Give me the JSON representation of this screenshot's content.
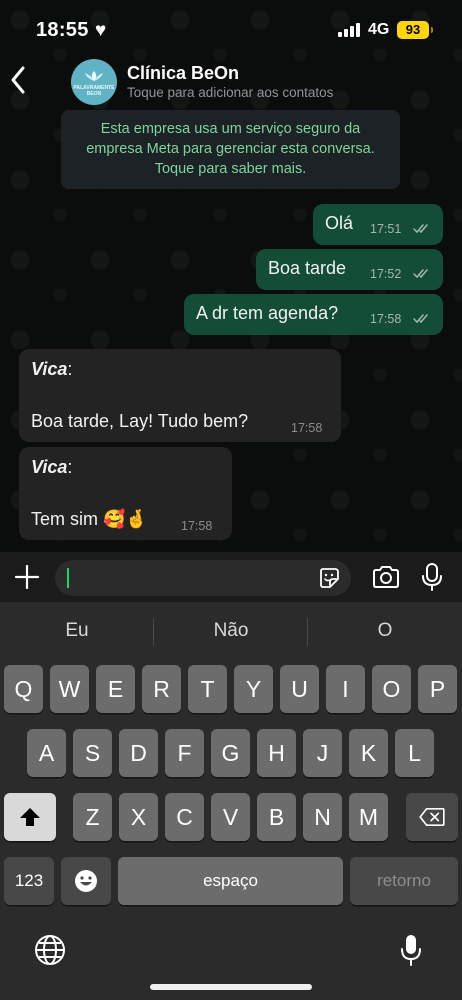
{
  "status_bar": {
    "time": "18:55",
    "heart_icon": "heart-icon",
    "network": "4G",
    "battery": "93",
    "battery_color": "#ffd60a"
  },
  "header": {
    "contact_name": "Clínica BeOn",
    "subtitle": "Toque para adicionar aos contatos",
    "avatar_text": "PALAVRAMENTE BEON"
  },
  "notice": {
    "text": "Esta empresa usa um serviço seguro da empresa Meta para gerenciar esta conversa. Toque para saber mais."
  },
  "messages": [
    {
      "direction": "out",
      "text": "Olá",
      "time": "17:51",
      "status": "read"
    },
    {
      "direction": "out",
      "text": "Boa tarde",
      "time": "17:52",
      "status": "read"
    },
    {
      "direction": "out",
      "text": "A dr tem agenda?",
      "time": "17:58",
      "status": "read"
    },
    {
      "direction": "in",
      "sender": "Vica",
      "text": "Boa tarde, Lay! Tudo bem?",
      "time": "17:58"
    },
    {
      "direction": "in",
      "sender": "Vica",
      "text": "Tem sim 🥰🤞",
      "time": "17:58"
    }
  ],
  "input": {
    "value": "",
    "placeholder": ""
  },
  "keyboard": {
    "suggestions": [
      "Eu",
      "Não",
      "O"
    ],
    "row1": [
      "Q",
      "W",
      "E",
      "R",
      "T",
      "Y",
      "U",
      "I",
      "O",
      "P"
    ],
    "row2": [
      "A",
      "S",
      "D",
      "F",
      "G",
      "H",
      "J",
      "K",
      "L"
    ],
    "row3": [
      "Z",
      "X",
      "C",
      "V",
      "B",
      "N",
      "M"
    ],
    "numbers_key": "123",
    "space_key": "espaço",
    "return_key": "retorno"
  },
  "colors": {
    "outgoing_bubble": "#134d37",
    "incoming_bubble": "#232323",
    "notice_text": "#7fd49c",
    "read_ticks": "#a7b6ad"
  }
}
